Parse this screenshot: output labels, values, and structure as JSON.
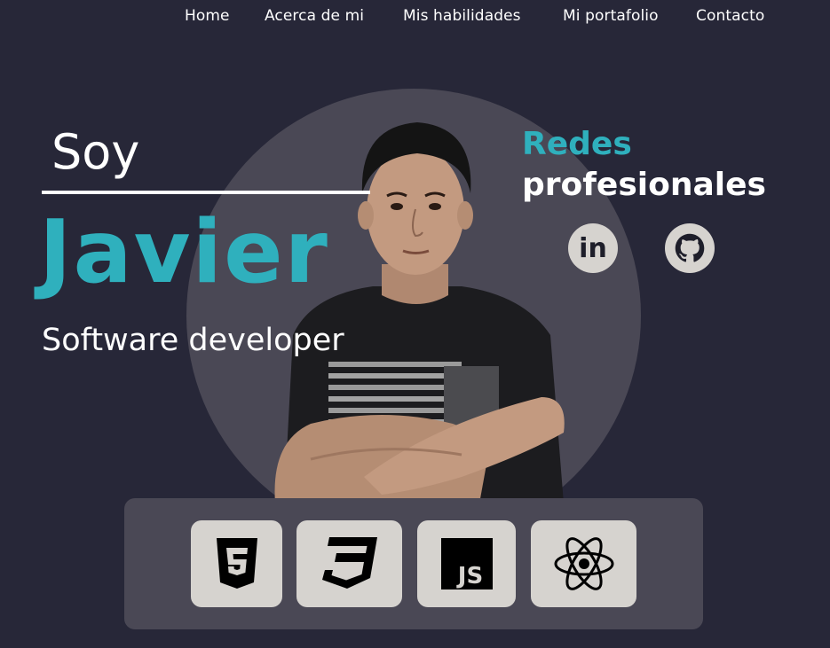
{
  "nav": {
    "home": "Home",
    "about": "Acerca de mi",
    "skills": "Mis habilidades",
    "portfolio": "Mi portafolio",
    "contact": "Contacto"
  },
  "intro": {
    "greeting": "Soy",
    "name": "Javier",
    "role": "Software developer"
  },
  "social": {
    "title_accent": "Redes",
    "title_main": "profesionales",
    "links": [
      {
        "name": "LinkedIn",
        "icon": "linkedin-icon",
        "glyph": "in"
      },
      {
        "name": "GitHub",
        "icon": "github-icon"
      }
    ]
  },
  "skills": [
    {
      "icon": "html5-icon"
    },
    {
      "icon": "css3-icon"
    },
    {
      "icon": "javascript-icon",
      "glyph": "JS"
    },
    {
      "icon": "react-icon"
    }
  ],
  "colors": {
    "background": "#272738",
    "accent": "#2fb0bd",
    "panel": "#4a4855",
    "tile": "#d6d3cf"
  }
}
